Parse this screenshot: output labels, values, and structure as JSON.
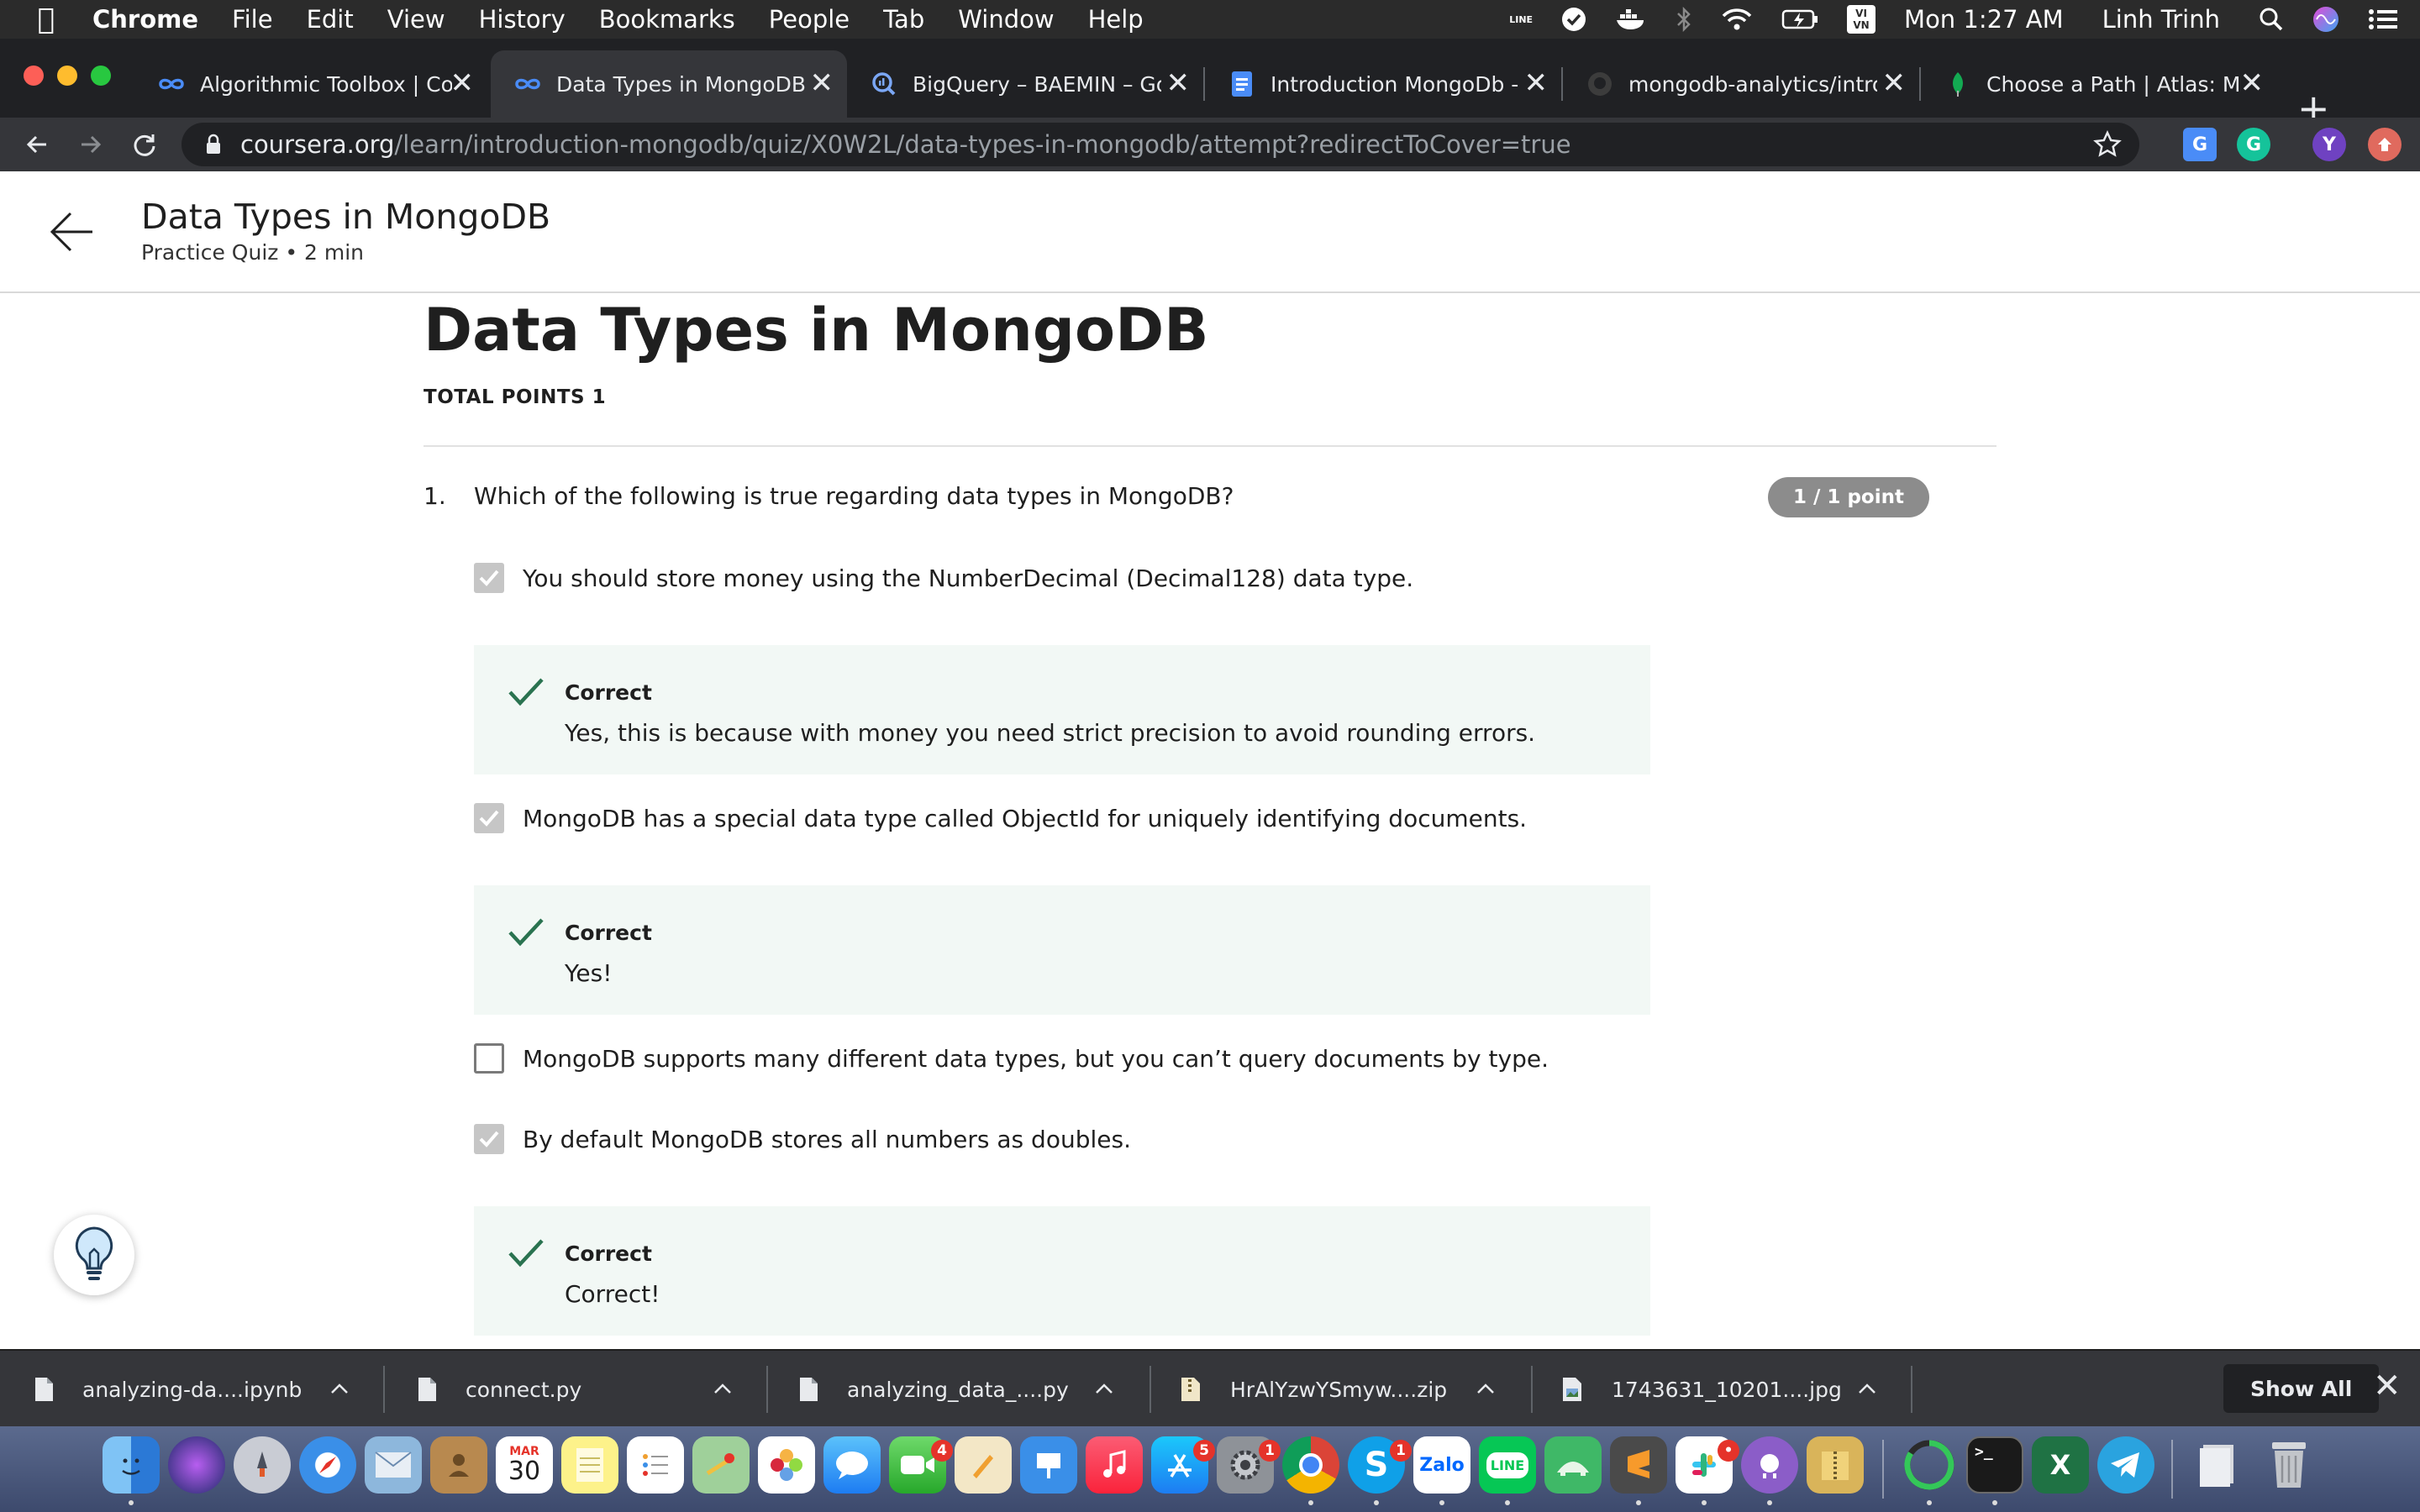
{
  "menubar": {
    "app_name": "Chrome",
    "items": [
      "File",
      "Edit",
      "View",
      "History",
      "Bookmarks",
      "People",
      "Tab",
      "Window",
      "Help"
    ],
    "clock": "Mon 1:27 AM",
    "user": "Linh Trinh",
    "status_icons": [
      "line-icon",
      "checkmark-circle-icon",
      "docker-icon",
      "bluetooth-icon",
      "wifi-icon",
      "battery-charging-icon",
      "input-method-vi-icon",
      "search-icon",
      "siri-icon",
      "notification-center-icon"
    ],
    "input_method_label": "VI\nVN"
  },
  "tabs": [
    {
      "label": "Algorithmic Toolbox | Coursera",
      "icon": "coursera-icon",
      "active": false
    },
    {
      "label": "Data Types in MongoDB | Coursera",
      "icon": "coursera-icon",
      "active": true
    },
    {
      "label": "BigQuery – BAEMIN – Google Cloud",
      "icon": "bigquery-icon",
      "active": false
    },
    {
      "label": "Introduction MongoDb - Google Docs",
      "icon": "google-docs-icon",
      "active": false
    },
    {
      "label": "mongodb-analytics/intro-to",
      "icon": "github-icon",
      "active": false
    },
    {
      "label": "Choose a Path | Atlas: MongoDB",
      "icon": "mongodb-leaf-icon",
      "active": false
    }
  ],
  "address_bar": {
    "host": "coursera.org",
    "path": "/learn/introduction-mongodb/quiz/X0W2L/data-types-in-mongodb/attempt?redirectToCover=true"
  },
  "extensions": {
    "profile_initial": "Y"
  },
  "page_header": {
    "title": "Data Types in MongoDB",
    "subtitle": "Practice Quiz • 2 min"
  },
  "quiz": {
    "title": "Data Types in MongoDB",
    "total_points": "TOTAL POINTS 1",
    "question_number": "1.",
    "question_text": "Which of the following is true regarding data types in MongoDB?",
    "points_badge": "1 / 1 point",
    "options": [
      {
        "text": "You should store money using the NumberDecimal (Decimal128) data type.",
        "checked": true
      },
      {
        "text": "MongoDB has a special data type called ObjectId for uniquely identifying documents.",
        "checked": true
      },
      {
        "text": "MongoDB supports many different data types, but you can’t query documents by type.",
        "checked": false
      },
      {
        "text": "By default MongoDB stores all numbers as doubles.",
        "checked": true
      }
    ],
    "feedback": [
      {
        "label": "Correct",
        "text": "Yes, this is because with money you need strict precision to avoid rounding errors."
      },
      {
        "label": "Correct",
        "text": "Yes!"
      },
      {
        "label": "Correct",
        "text": "Correct!"
      }
    ]
  },
  "downloads": {
    "items": [
      {
        "name": "analyzing-da....ipynb",
        "icon": "file-icon"
      },
      {
        "name": "connect.py",
        "icon": "file-icon"
      },
      {
        "name": "analyzing_data_....py",
        "icon": "file-icon"
      },
      {
        "name": "HrAlYzwYSmyw....zip",
        "icon": "zip-file-icon"
      },
      {
        "name": "1743631_10201....jpg",
        "icon": "image-file-icon"
      }
    ],
    "show_all": "Show All"
  },
  "dock": {
    "calendar_month": "MAR",
    "calendar_day": "30",
    "facetime_badge": "4",
    "appstore_badge": "5",
    "sysprefs_badge": "1",
    "skype_badge": "1",
    "slack_badge": "•",
    "zalo_label": "Zalo",
    "line_label": "LINE",
    "skype_label": "S",
    "excel_label": "X"
  },
  "colors": {
    "check_green": "#2a7350",
    "feedback_bg": "#f2f8f5",
    "badge_gray": "#8c8c8c",
    "checkbox_checked": "#c6c6c6"
  }
}
